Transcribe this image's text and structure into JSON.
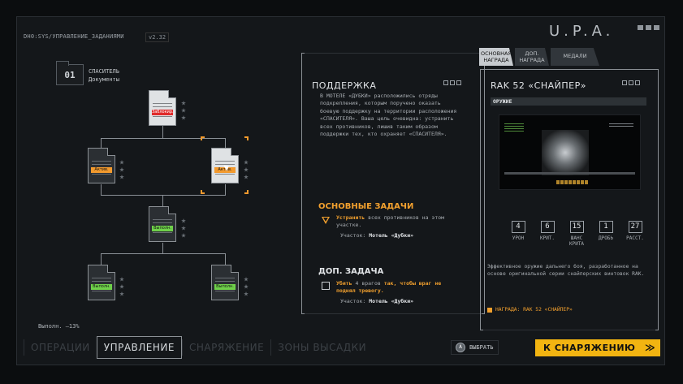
{
  "header": {
    "path": "DH0:SYS/УПРАВЛЕНИЕ_ЗАДАНИЯМИ",
    "version": "v2.32",
    "logo": "U.P.A."
  },
  "folder": {
    "number": "01",
    "title": "СПАСИТЕЛЬ",
    "subtitle": "Документы"
  },
  "tree": {
    "nodes": [
      {
        "tag": "Заблокир.",
        "status": "locked"
      },
      {
        "tag": "Актив.",
        "status": "active"
      },
      {
        "tag": "Актив.",
        "status": "active"
      },
      {
        "tag": "Выполн.",
        "status": "done"
      },
      {
        "tag": "Выполн.",
        "status": "done"
      },
      {
        "tag": "Выполн.",
        "status": "done"
      }
    ],
    "completion": "Выполн. —13%"
  },
  "mission": {
    "title": "ПОДДЕРЖКА",
    "description": "В МОТЕЛЕ «ДУБКИ» расположились отряды подкрепления, которым поручено оказать боевую поддержку на территории расположения «СПАСИТЕЛЯ». Ваша цель очевидна: устранить всех противников, лишив таким образом поддержки тех, кто охраняет «СПАСИТЕЛЯ».",
    "main_title": "ОСНОВНЫЕ ЗАДАЧИ",
    "main_task_hl": "Устранить",
    "main_task_rest": " всех противников на этом участке.",
    "main_location_label": "Участок:",
    "main_location": "Мотель «Дубки»",
    "side_title": "ДОП. ЗАДАЧА",
    "side_task_hl": "Убить",
    "side_task_mid": " 4 врагов ",
    "side_task_hl2": "так, чтобы враг не поднял тревогу.",
    "side_location_label": "Участок:",
    "side_location": "Мотель «Дубки»"
  },
  "reward_tabs": [
    "ОСНОВНАЯ НАГРАДА",
    "ДОП. НАГРАДА",
    "МЕДАЛИ"
  ],
  "reward": {
    "title": "RAK 52 «СНАЙПЕР»",
    "category": "ОРУЖИЕ",
    "stats": [
      {
        "value": "4",
        "label": "УРОН"
      },
      {
        "value": "6",
        "label": "КРИТ."
      },
      {
        "value": "15",
        "label": "ШАНС КРИТА"
      },
      {
        "value": "1",
        "label": "ДРОБЬ"
      },
      {
        "value": "27",
        "label": "РАССТ."
      }
    ],
    "description": "Эффективное оружие дальнего боя, разработанное на основе оригинальной серии снайперских винтовок RAK.",
    "reward_line": "НАГРАДА: RAK 52 «СНАЙПЕР»"
  },
  "nav": {
    "items": [
      "ОПЕРАЦИИ",
      "УПРАВЛЕНИЕ",
      "СНАРЯЖЕНИЕ",
      "ЗОНЫ ВЫСАДКИ"
    ],
    "active_index": 1,
    "select_icon": "A",
    "select_label": "ВЫБРАТЬ",
    "equip_label": "К СНАРЯЖЕНИЮ",
    "equip_arrow": "≫"
  },
  "colors": {
    "accent": "#f2b411",
    "orange": "#f29a2e",
    "locked": "#e02a2a",
    "done": "#6fd14a"
  }
}
